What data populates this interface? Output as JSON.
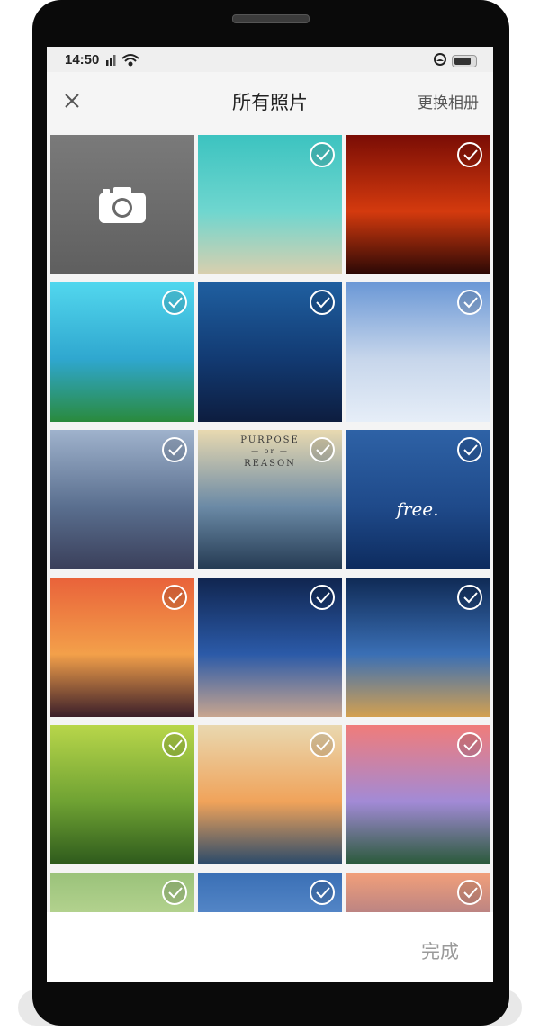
{
  "status": {
    "time": "14:50"
  },
  "header": {
    "title": "所有照片",
    "switch_album": "更换相册"
  },
  "footer": {
    "done_label": "完成"
  },
  "photos": [
    {
      "kind": "camera",
      "colors": [
        "#7a7a7a",
        "#5f5f5f"
      ]
    },
    {
      "kind": "photo",
      "colors": [
        "#3cc3c0",
        "#6fd6cf",
        "#d9cfae"
      ],
      "checked": true
    },
    {
      "kind": "photo",
      "colors": [
        "#7a0d05",
        "#d43a0e",
        "#2b0805"
      ],
      "checked": true
    },
    {
      "kind": "photo",
      "colors": [
        "#52d7ee",
        "#2fa7cf",
        "#2a8a3d"
      ],
      "checked": true
    },
    {
      "kind": "photo",
      "colors": [
        "#1f5fa0",
        "#123a72",
        "#0d1d3f"
      ],
      "checked": true
    },
    {
      "kind": "photo",
      "colors": [
        "#6b98d6",
        "#c7d6eb",
        "#e6eef8"
      ],
      "checked": true
    },
    {
      "kind": "photo",
      "colors": [
        "#9fb2cc",
        "#5a6f8f",
        "#3a3f5a"
      ],
      "checked": true
    },
    {
      "kind": "photo",
      "colors": [
        "#e8d9b0",
        "#6b8aa6",
        "#243a52"
      ],
      "checked": true,
      "text": [
        "PURPOSE",
        "— or —",
        "REASON"
      ]
    },
    {
      "kind": "photo",
      "colors": [
        "#2e62a6",
        "#1f4a8a",
        "#0d2b5e"
      ],
      "checked": true,
      "script": "free."
    },
    {
      "kind": "photo",
      "colors": [
        "#e9623a",
        "#f3a04a",
        "#3b1f2a"
      ],
      "checked": true
    },
    {
      "kind": "photo",
      "colors": [
        "#10254f",
        "#2b5aa8",
        "#c8a58f"
      ],
      "checked": true
    },
    {
      "kind": "photo",
      "colors": [
        "#0f2a55",
        "#3a6fb5",
        "#d3a050"
      ],
      "checked": true
    },
    {
      "kind": "photo",
      "colors": [
        "#b8d64a",
        "#6fa233",
        "#2e5a1c"
      ],
      "checked": true
    },
    {
      "kind": "photo",
      "colors": [
        "#e9d8b0",
        "#f0a35a",
        "#2a4a6a"
      ],
      "checked": true
    },
    {
      "kind": "photo",
      "colors": [
        "#f07c7a",
        "#a28ad6",
        "#2a5a3a"
      ],
      "checked": true
    },
    {
      "kind": "photo",
      "colors": [
        "#9ac27a",
        "#c9e0a0",
        "#5f8a3a"
      ],
      "checked": true
    },
    {
      "kind": "photo",
      "colors": [
        "#3a6fb5",
        "#6a9ad6",
        "#a8c4e0"
      ],
      "checked": true
    },
    {
      "kind": "photo",
      "colors": [
        "#f2a07a",
        "#8a6a8a",
        "#3a3a4a"
      ],
      "checked": true
    }
  ]
}
